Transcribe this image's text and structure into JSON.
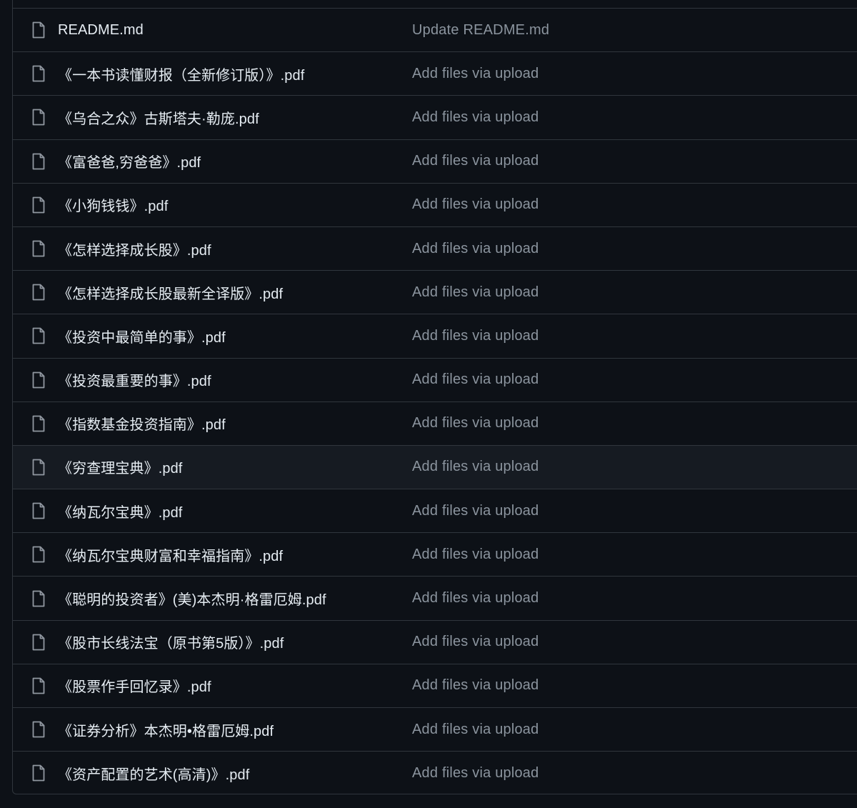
{
  "files": [
    {
      "name": "README.md",
      "commit": "Update README.md"
    },
    {
      "name": "《一本书读懂财报（全新修订版）》.pdf",
      "commit": "Add files via upload"
    },
    {
      "name": "《乌合之众》古斯塔夫·勒庞.pdf",
      "commit": "Add files via upload"
    },
    {
      "name": "《富爸爸,穷爸爸》.pdf",
      "commit": "Add files via upload"
    },
    {
      "name": "《小狗钱钱》.pdf",
      "commit": "Add files via upload"
    },
    {
      "name": "《怎样选择成长股》.pdf",
      "commit": "Add files via upload"
    },
    {
      "name": "《怎样选择成长股最新全译版》.pdf",
      "commit": "Add files via upload"
    },
    {
      "name": "《投资中最简单的事》.pdf",
      "commit": "Add files via upload"
    },
    {
      "name": "《投资最重要的事》.pdf",
      "commit": "Add files via upload"
    },
    {
      "name": "《指数基金投资指南》.pdf",
      "commit": "Add files via upload"
    },
    {
      "name": "《穷查理宝典》.pdf",
      "commit": "Add files via upload"
    },
    {
      "name": "《纳瓦尔宝典》.pdf",
      "commit": "Add files via upload"
    },
    {
      "name": "《纳瓦尔宝典财富和幸福指南》.pdf",
      "commit": "Add files via upload"
    },
    {
      "name": "《聪明的投资者》(美)本杰明·格雷厄姆.pdf",
      "commit": "Add files via upload"
    },
    {
      "name": "《股市长线法宝（原书第5版）》.pdf",
      "commit": "Add files via upload"
    },
    {
      "name": "《股票作手回忆录》.pdf",
      "commit": "Add files via upload"
    },
    {
      "name": "《证券分析》本杰明•格雷厄姆.pdf",
      "commit": "Add files via upload"
    },
    {
      "name": "《资产配置的艺术(高清)》.pdf",
      "commit": "Add files via upload"
    }
  ],
  "highlighted_row_index": 10,
  "icon": "file-icon",
  "colors": {
    "background": "#0d1117",
    "row_hover": "#161b22",
    "border": "#30363d",
    "file_name": "#e6edf3",
    "commit_message": "#8b949e"
  }
}
